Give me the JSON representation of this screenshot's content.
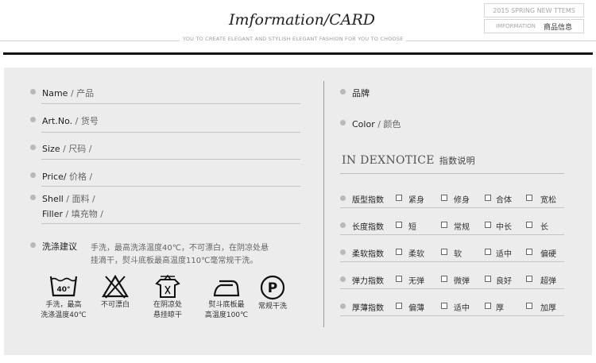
{
  "header": {
    "title": "Imformation/CARD",
    "tagline": "YOU TO  CREATE ELEGANT AND STYLISH ELEGANT FASHION FOR YOU TO CHOOSE",
    "badge_top": "2015 SPRING  NEW TTEMS",
    "badge_en": "IMFORMATION",
    "badge_cn": "商品信息"
  },
  "left_fields": [
    {
      "en": "Name",
      "cn": "/ 产品"
    },
    {
      "en": "Art.No.",
      "cn": "/ 货号"
    },
    {
      "en": "Size",
      "cn": "/ 尺码 /"
    },
    {
      "en": "Price/",
      "cn": " 价格 /"
    },
    {
      "en": "Shell",
      "cn": "/ 面料 /"
    },
    {
      "en": "Filler",
      "cn": "/ 填充物  /"
    }
  ],
  "wash": {
    "label": "洗涤建议",
    "line1": "手洗，最高洗涤温度40℃，不可漂白，在阴凉处悬",
    "line2": "挂滴干，熨斗底板最高温度110℃毫常规干洗。"
  },
  "care_icons": [
    {
      "icon": "hand-wash-icon",
      "temp": "40°",
      "line1": "手洗，最高",
      "line2": "洗涤温度40℃"
    },
    {
      "icon": "no-bleach-icon",
      "line1": "不可漂白",
      "line2": ""
    },
    {
      "icon": "hang-dry-shade-icon",
      "line1": "在阴凉处",
      "line2": "悬挂晾干"
    },
    {
      "icon": "iron-icon",
      "line1": "熨斗底板最",
      "line2": "高温度100℃"
    },
    {
      "icon": "dry-clean-icon",
      "letter": "P",
      "line1": "常规干洗",
      "line2": ""
    }
  ],
  "right_fields": [
    {
      "en": "品牌",
      "cn": ""
    },
    {
      "en": "Color",
      "cn": "/ 颜色"
    }
  ],
  "index": {
    "title_en": "IN DEXNOTICE",
    "title_cn": "指数说明",
    "rows": [
      {
        "label": "版型指数",
        "options": [
          "紧身",
          "修身",
          "合体",
          "宽松"
        ]
      },
      {
        "label": "长度指数",
        "options": [
          "短",
          "常规",
          "中长",
          "长"
        ]
      },
      {
        "label": "柔软指数",
        "options": [
          "柔软",
          "软",
          "适中",
          "偏硬"
        ]
      },
      {
        "label": "弹力指数",
        "options": [
          "无弹",
          "微弹",
          "良好",
          "超弹"
        ]
      },
      {
        "label": "厚薄指数",
        "options": [
          "偏薄",
          "适中",
          "厚",
          "加厚"
        ]
      }
    ]
  }
}
